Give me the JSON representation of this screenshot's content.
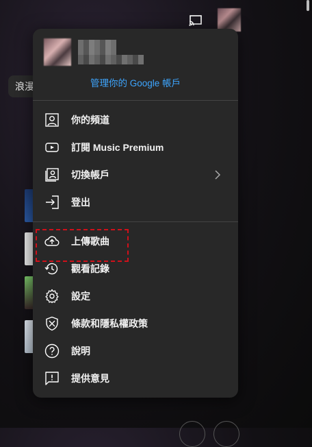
{
  "background": {
    "chip_label": "浪漫"
  },
  "account": {
    "manage_link": "管理你的 Google 帳戶"
  },
  "menu": {
    "section1": [
      {
        "label": "你的頻道",
        "icon": "person-icon"
      },
      {
        "label": "訂閱 Music Premium",
        "icon": "youtube-icon"
      },
      {
        "label": "切換帳戶",
        "icon": "switch-account-icon",
        "has_submenu": true
      },
      {
        "label": "登出",
        "icon": "sign-out-icon"
      }
    ],
    "section2": [
      {
        "label": "上傳歌曲",
        "icon": "upload-cloud-icon",
        "highlighted": true
      },
      {
        "label": "觀看記錄",
        "icon": "history-icon"
      },
      {
        "label": "設定",
        "icon": "gear-icon"
      },
      {
        "label": "條款和隱私權政策",
        "icon": "shield-icon"
      },
      {
        "label": "說明",
        "icon": "help-icon"
      },
      {
        "label": "提供意見",
        "icon": "feedback-icon"
      }
    ]
  },
  "colors": {
    "accent_link": "#3ea6ff",
    "highlight_border": "#d0101a",
    "menu_bg": "#282828"
  }
}
